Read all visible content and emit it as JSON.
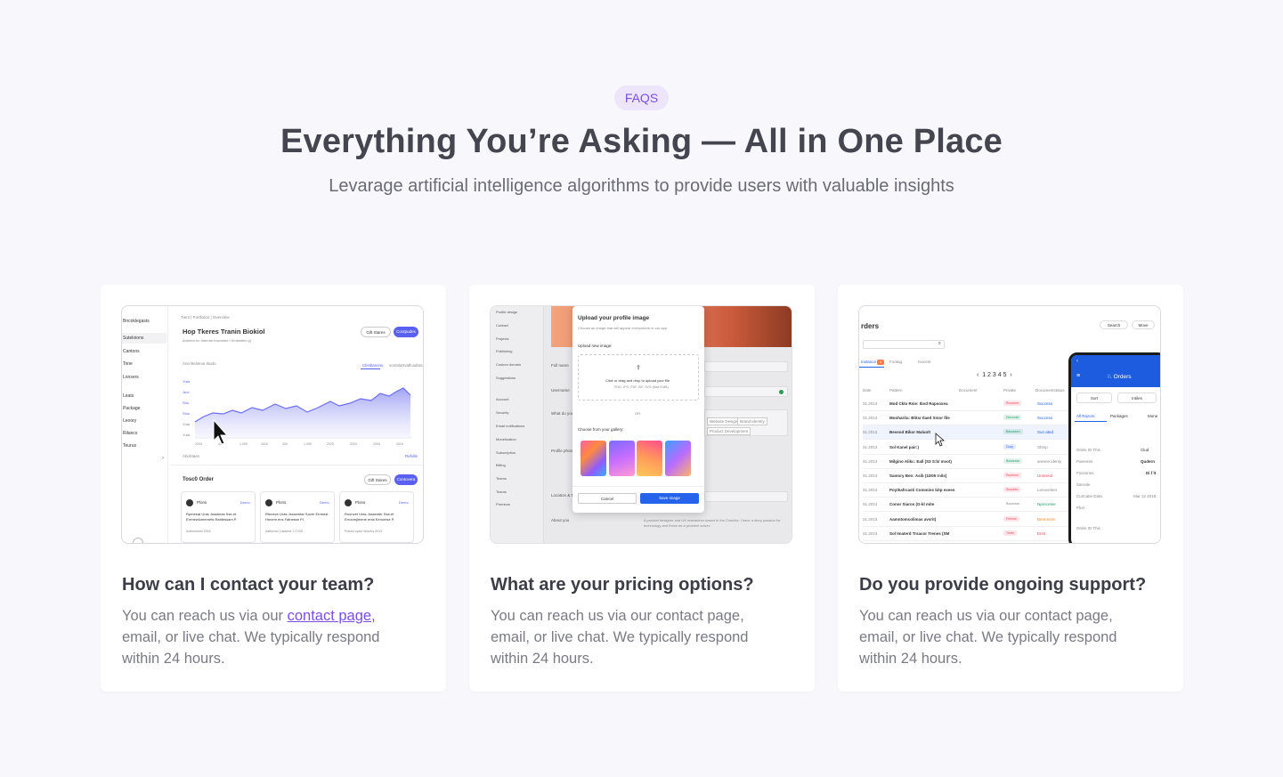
{
  "header": {
    "badge": "FAQS",
    "title": "Everything You’re Asking — All in One Place",
    "subtitle": "Levarage artificial intelligence algorithms to provide users with valuable insights"
  },
  "colors": {
    "accent": "#7b4ee0",
    "background": "#f8f7fb",
    "card": "#ffffff",
    "blue": "#2563eb"
  },
  "cards": [
    {
      "question": "How can I contact your team?",
      "answer_prefix": "You can reach us via our ",
      "answer_link": "contact page,",
      "answer_suffix": " email, or live chat. We typically respond within 24 hours.",
      "shot": {
        "breadcrumb": "Tiers  |  Portfolios  |  Overview",
        "heading": "Hop Tkeres Tranin Biokiol",
        "subheading": "Anbefor en Intemte Insomble t Kmtoktten pj",
        "btn_outline": "Gift Stares",
        "btn_fill": "Cootpudes",
        "sidebar": [
          "Bncoklegasts",
          "Suteloions",
          "Cantons",
          "Tone",
          "Lonsers",
          "Leats",
          "Package",
          "Leoory",
          "Rilancs",
          "Teurus"
        ],
        "chart_label": "Ann Belinnor Budo",
        "chart_tab1": "Clistbasons",
        "chart_tab2": "somnlatrvaflcadras",
        "y_ticks": [
          "Yuta",
          "Jeol",
          "Shu",
          "Shlo",
          "Yuta",
          "Yuta"
        ],
        "x_ticks": [
          "2003",
          "31",
          "1,005",
          "2015",
          "300",
          "1,005",
          "2023",
          "2003",
          "2003",
          "2015"
        ],
        "footer_left": "Abohtaes",
        "footer_right": "Refolle",
        "section2_title": "Tosc0 Order",
        "section2_btn1": "Gift Stores",
        "section2_btn2": "Contovera",
        "mini_cards": [
          {
            "name": "Plons",
            "tag": "Demo",
            "text": "Rpmeeat Uras Jsssbeas Sse-et Errmewlumernets Rahtessam P.",
            "meta": "Auftonoeem 2018"
          },
          {
            "name": "Plons",
            "tag": "Demo",
            "text": "Rbmeve Uras Jsssemtar Sover Errmest Hnnem ens Fatnesse Pl.",
            "meta": "Aafturnes  Cataerer  2.0 200"
          },
          {
            "name": "Plons",
            "tag": "Demo",
            "text": "Rnonvet Uras Jsssenter Sse-et Erroomjlmene ents Kenomse P.",
            "meta": "Pubesl oyam  Wonery 2013"
          }
        ]
      }
    },
    {
      "question": "What are your pricing options?",
      "answer_text": "You can reach us via our contact page, email, or live chat. We typically respond within 24 hours.",
      "shot": {
        "sidebar": [
          "Profile design",
          "Contact",
          "Projects",
          "Publishing",
          "Custom domain",
          "Suggestions",
          "Account",
          "Security",
          "Email notifications",
          "Monetization",
          "Subscription",
          "Billing",
          "Teams",
          "Teams",
          "Premium"
        ],
        "modal_title": "Upload your profile image",
        "modal_sub": "Choose an image that will appear everywhere in our app.",
        "upload_label": "Upload new image:",
        "upload_drop": "Click or drag and drop to upload your file",
        "upload_types": "PNG, JPG, PDF, GIF, SVG (Max 5 MB)",
        "or": "OR",
        "gallery_label": "Choose from your gallery:",
        "cancel": "Cancel",
        "save": "Save image",
        "fields": [
          "Full name",
          "Username",
          "What do you",
          "Profile photo",
          "Location & Ti",
          "About you"
        ],
        "about_placeholder": "A product designer and UX researcher based in the Czechia. I have a deep passion for technology and thrive as a problem solver.",
        "chips": [
          "Website Design",
          "Brand Identity",
          "Product Development"
        ]
      }
    },
    {
      "question": "Do you provide ongoing support?",
      "answer_text": "You can reach us via our contact page, email, or live chat. We typically respond within 24 hours.",
      "shot": {
        "title": "rders",
        "search": "Search",
        "move": "Move",
        "tabs": [
          "Instance",
          "Footag",
          "Isocent"
        ],
        "col_headers": [
          "Date",
          "Pattern",
          "Document",
          "Private",
          "Documentstatus"
        ],
        "rows": [
          {
            "date": "31.2013",
            "name": "Mod Cklo Rsie: Ibvd Rapsoxea",
            "status": "Rocsrere",
            "state": "Success"
          },
          {
            "date": "31.2013",
            "name": "Mooharita: Blitsr Ilaed Sinor file",
            "status": "Disconse",
            "state": "Success"
          },
          {
            "date": "31.2013",
            "name": "Beseod Bikor Malunlt",
            "status": "Bausesen",
            "state": "Sun ated"
          },
          {
            "date": "31.2013",
            "name": "Sol Kanel pair:)",
            "status": "Cusy",
            "state": "Shmp"
          },
          {
            "date": "31.2013",
            "name": "Milgino Alikc: Eall (S3 S:b/ mvot)",
            "status": "Bossesse",
            "state": "anrene identy"
          },
          {
            "date": "31.2013",
            "name": "Samory Beo: Asib (1D05 rnils)",
            "status": "Rucenes",
            "state": "Unntend"
          },
          {
            "date": "31.2013",
            "name": "Poytkafrcasti Commins bitp exeen",
            "status": "Sucsees",
            "state": "Lenoveleer"
          },
          {
            "date": "31.2013",
            "name": "Conor Siaros (G-kl mite",
            "status": "Bossesse",
            "state": "Nprecetee"
          },
          {
            "date": "31.2013",
            "name": "Aamntomcolimas avsrit)",
            "status": "Frmose",
            "state": "Bemrezen"
          },
          {
            "date": "31.2013",
            "name": "Sol Imaterd Trsacor Trenes (SM",
            "status": "Tmler",
            "state": "Ennt"
          }
        ],
        "phone": {
          "title": "Orders",
          "sort": "Sort",
          "filter": "Intiles",
          "tabs": [
            "All Razors",
            "Packages",
            "Mone"
          ],
          "fields": [
            "Order ID This",
            "Paerener",
            "Fsceones",
            "Saroole",
            "Curtcatie Data",
            "Plurr",
            "Order ID This"
          ],
          "values": [
            "Clud",
            "Qudern",
            "Di f lt",
            "",
            "Mar 12 2018",
            "",
            ""
          ]
        }
      }
    }
  ]
}
